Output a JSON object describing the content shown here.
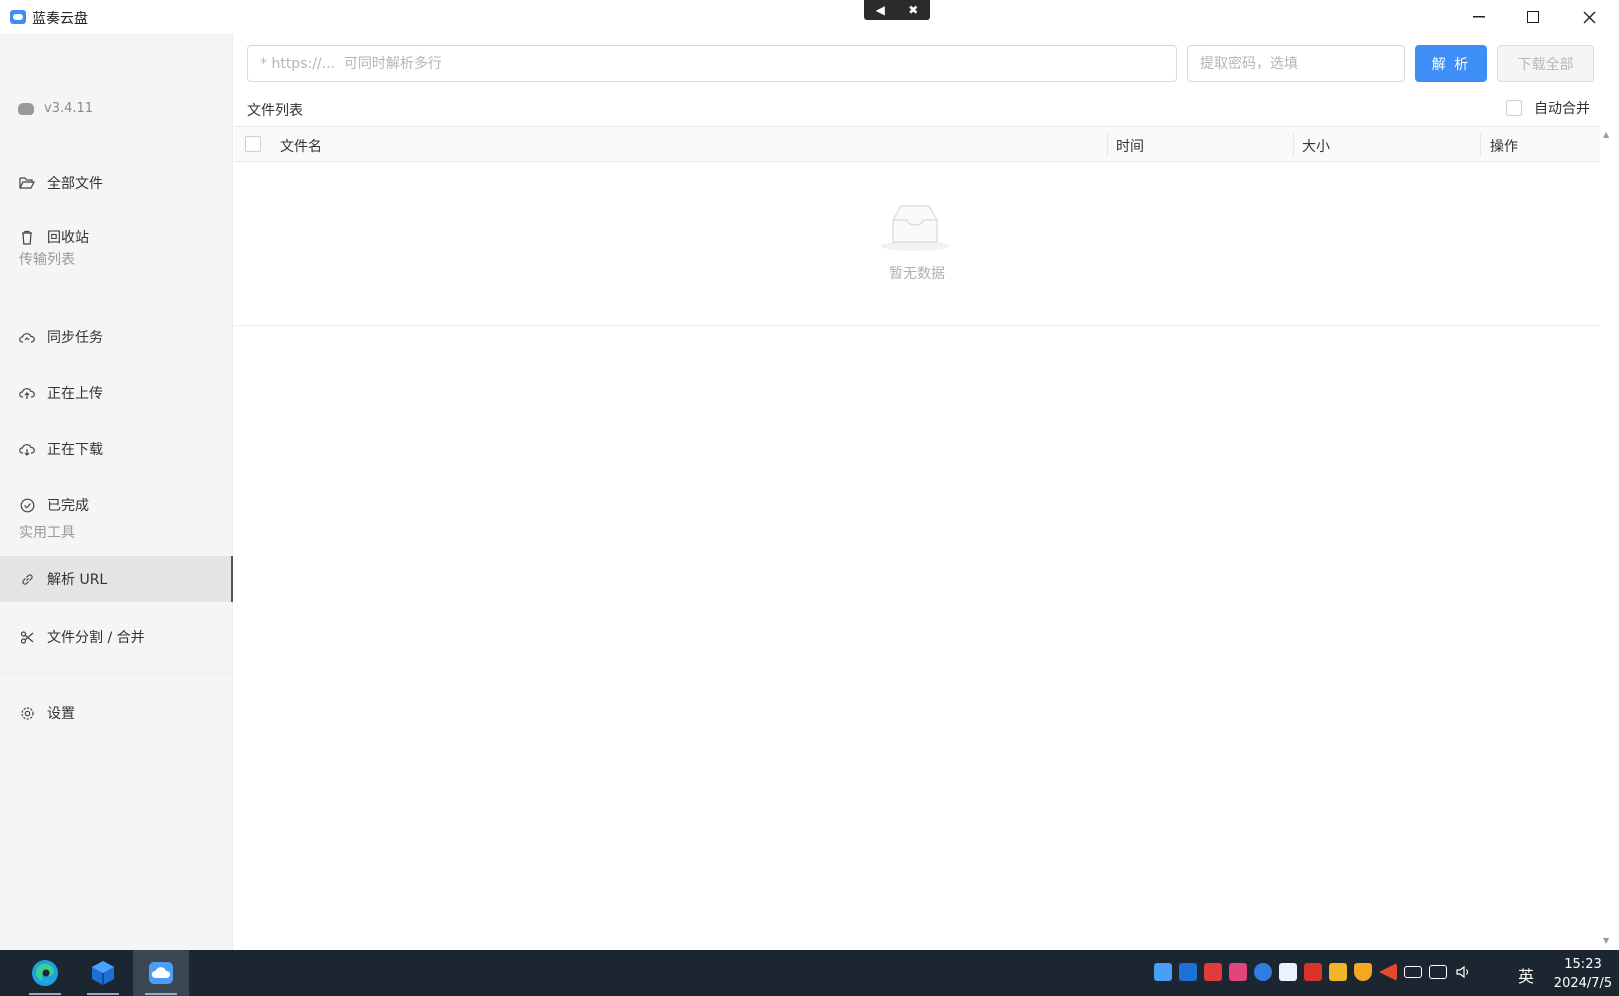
{
  "window": {
    "title": "蓝奏云盘"
  },
  "sidebar": {
    "version": "v3.4.11",
    "items": [
      {
        "label": "全部文件",
        "icon": "folder-open-icon"
      },
      {
        "label": "回收站",
        "icon": "trash-icon"
      },
      {
        "label": "同步任务",
        "icon": "cloud-sync-icon"
      },
      {
        "label": "正在上传",
        "icon": "cloud-upload-icon"
      },
      {
        "label": "正在下载",
        "icon": "cloud-download-icon"
      },
      {
        "label": "已完成",
        "icon": "check-circle-icon"
      },
      {
        "label": "解析 URL",
        "icon": "link-icon"
      },
      {
        "label": "文件分割 / 合并",
        "icon": "scissors-icon"
      },
      {
        "label": "设置",
        "icon": "gear-icon"
      }
    ],
    "sections": {
      "transfer": "传输列表",
      "tools": "实用工具"
    },
    "active_item": "解析 URL"
  },
  "main": {
    "url_placeholder": "* https://...  可同时解析多行",
    "password_placeholder": "提取密码，选填",
    "parse_button": "解 析",
    "download_all_button": "下载全部",
    "file_list_label": "文件列表",
    "auto_merge_label": "自动合并",
    "table": {
      "columns": [
        "文件名",
        "时间",
        "大小",
        "操作"
      ]
    },
    "empty_text": "暂无数据"
  },
  "taskbar": {
    "language": "英",
    "time": "15:23",
    "date": "2024/7/5"
  },
  "colors": {
    "accent": "#3e8ef7",
    "sidebar_bg": "#f5f5f5",
    "taskbar_bg": "#1c2630"
  }
}
